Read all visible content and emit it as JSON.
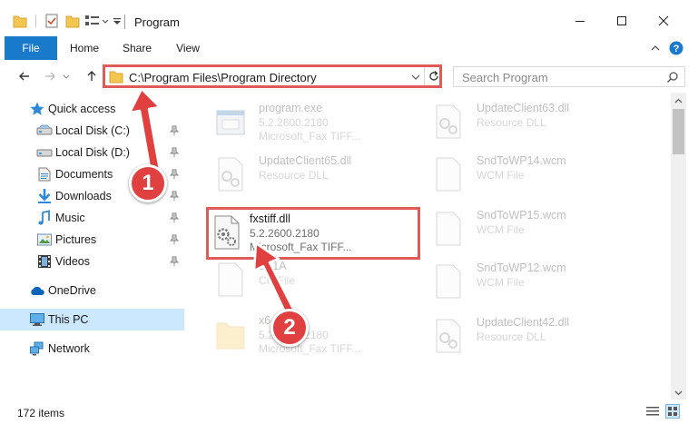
{
  "window": {
    "title": "Program",
    "accent_color": "#1979ca",
    "highlight_color": "#e05a59"
  },
  "ribbon": {
    "tabs": [
      {
        "label": "File"
      },
      {
        "label": "Home"
      },
      {
        "label": "Share"
      },
      {
        "label": "View"
      }
    ]
  },
  "address": {
    "path": "C:\\Program Files\\Program Directory"
  },
  "search": {
    "placeholder": "Search Program"
  },
  "nav": {
    "items": [
      {
        "label": "Quick access",
        "icon": "star-icon",
        "pinned": false
      },
      {
        "label": "Local Disk (C:)",
        "icon": "drive-icon",
        "pinned": true
      },
      {
        "label": "Local Disk (D:)",
        "icon": "drive-icon",
        "pinned": true
      },
      {
        "label": "Documents",
        "icon": "documents-icon",
        "pinned": true
      },
      {
        "label": "Downloads",
        "icon": "download-icon",
        "pinned": true
      },
      {
        "label": "Music",
        "icon": "music-icon",
        "pinned": true
      },
      {
        "label": "Pictures",
        "icon": "pictures-icon",
        "pinned": true
      },
      {
        "label": "Videos",
        "icon": "videos-icon",
        "pinned": true
      },
      {
        "label": "OneDrive",
        "icon": "cloud-icon",
        "pinned": false
      },
      {
        "label": "This PC",
        "icon": "computer-icon",
        "pinned": false,
        "selected": true
      },
      {
        "label": "Network",
        "icon": "network-icon",
        "pinned": false
      }
    ]
  },
  "files": {
    "left": [
      {
        "name": "program.exe",
        "line2": "5.2.2600.2180",
        "line3": "Microsoft_Fax TIFF...",
        "icon": "exe-icon"
      },
      {
        "name": "UpdateClient65.dll",
        "line2": "Resource DLL",
        "line3": "",
        "icon": "dll-icon"
      },
      {
        "name": "fxstiff.dll",
        "line2": "5.2.2600.2180",
        "line3": "Microsoft_Fax TIFF...",
        "icon": "dll-icon"
      },
      {
        "name": "8K1A",
        "line2": "CR File",
        "line3": "",
        "icon": "file-icon"
      },
      {
        "name": "x64",
        "line2": "5.2.2600.2180",
        "line3": "Microsoft_Fax TIFF...",
        "icon": "folder-icon"
      }
    ],
    "right": [
      {
        "name": "UpdateClient63.dll",
        "line2": "Resource DLL",
        "line3": "",
        "icon": "dll-icon"
      },
      {
        "name": "SndToWP14.wcm",
        "line2": "WCM File",
        "line3": "",
        "icon": "file-icon"
      },
      {
        "name": "SndToWP15.wcm",
        "line2": "WCM File",
        "line3": "",
        "icon": "file-icon"
      },
      {
        "name": "SndToWP12.wcm",
        "line2": "WCM File",
        "line3": "",
        "icon": "file-icon"
      },
      {
        "name": "UpdateClient42.dll",
        "line2": "Resource DLL",
        "line3": "",
        "icon": "dll-icon"
      }
    ]
  },
  "status": {
    "item_count": "172 items"
  },
  "annotations": [
    {
      "label": "1"
    },
    {
      "label": "2"
    }
  ]
}
